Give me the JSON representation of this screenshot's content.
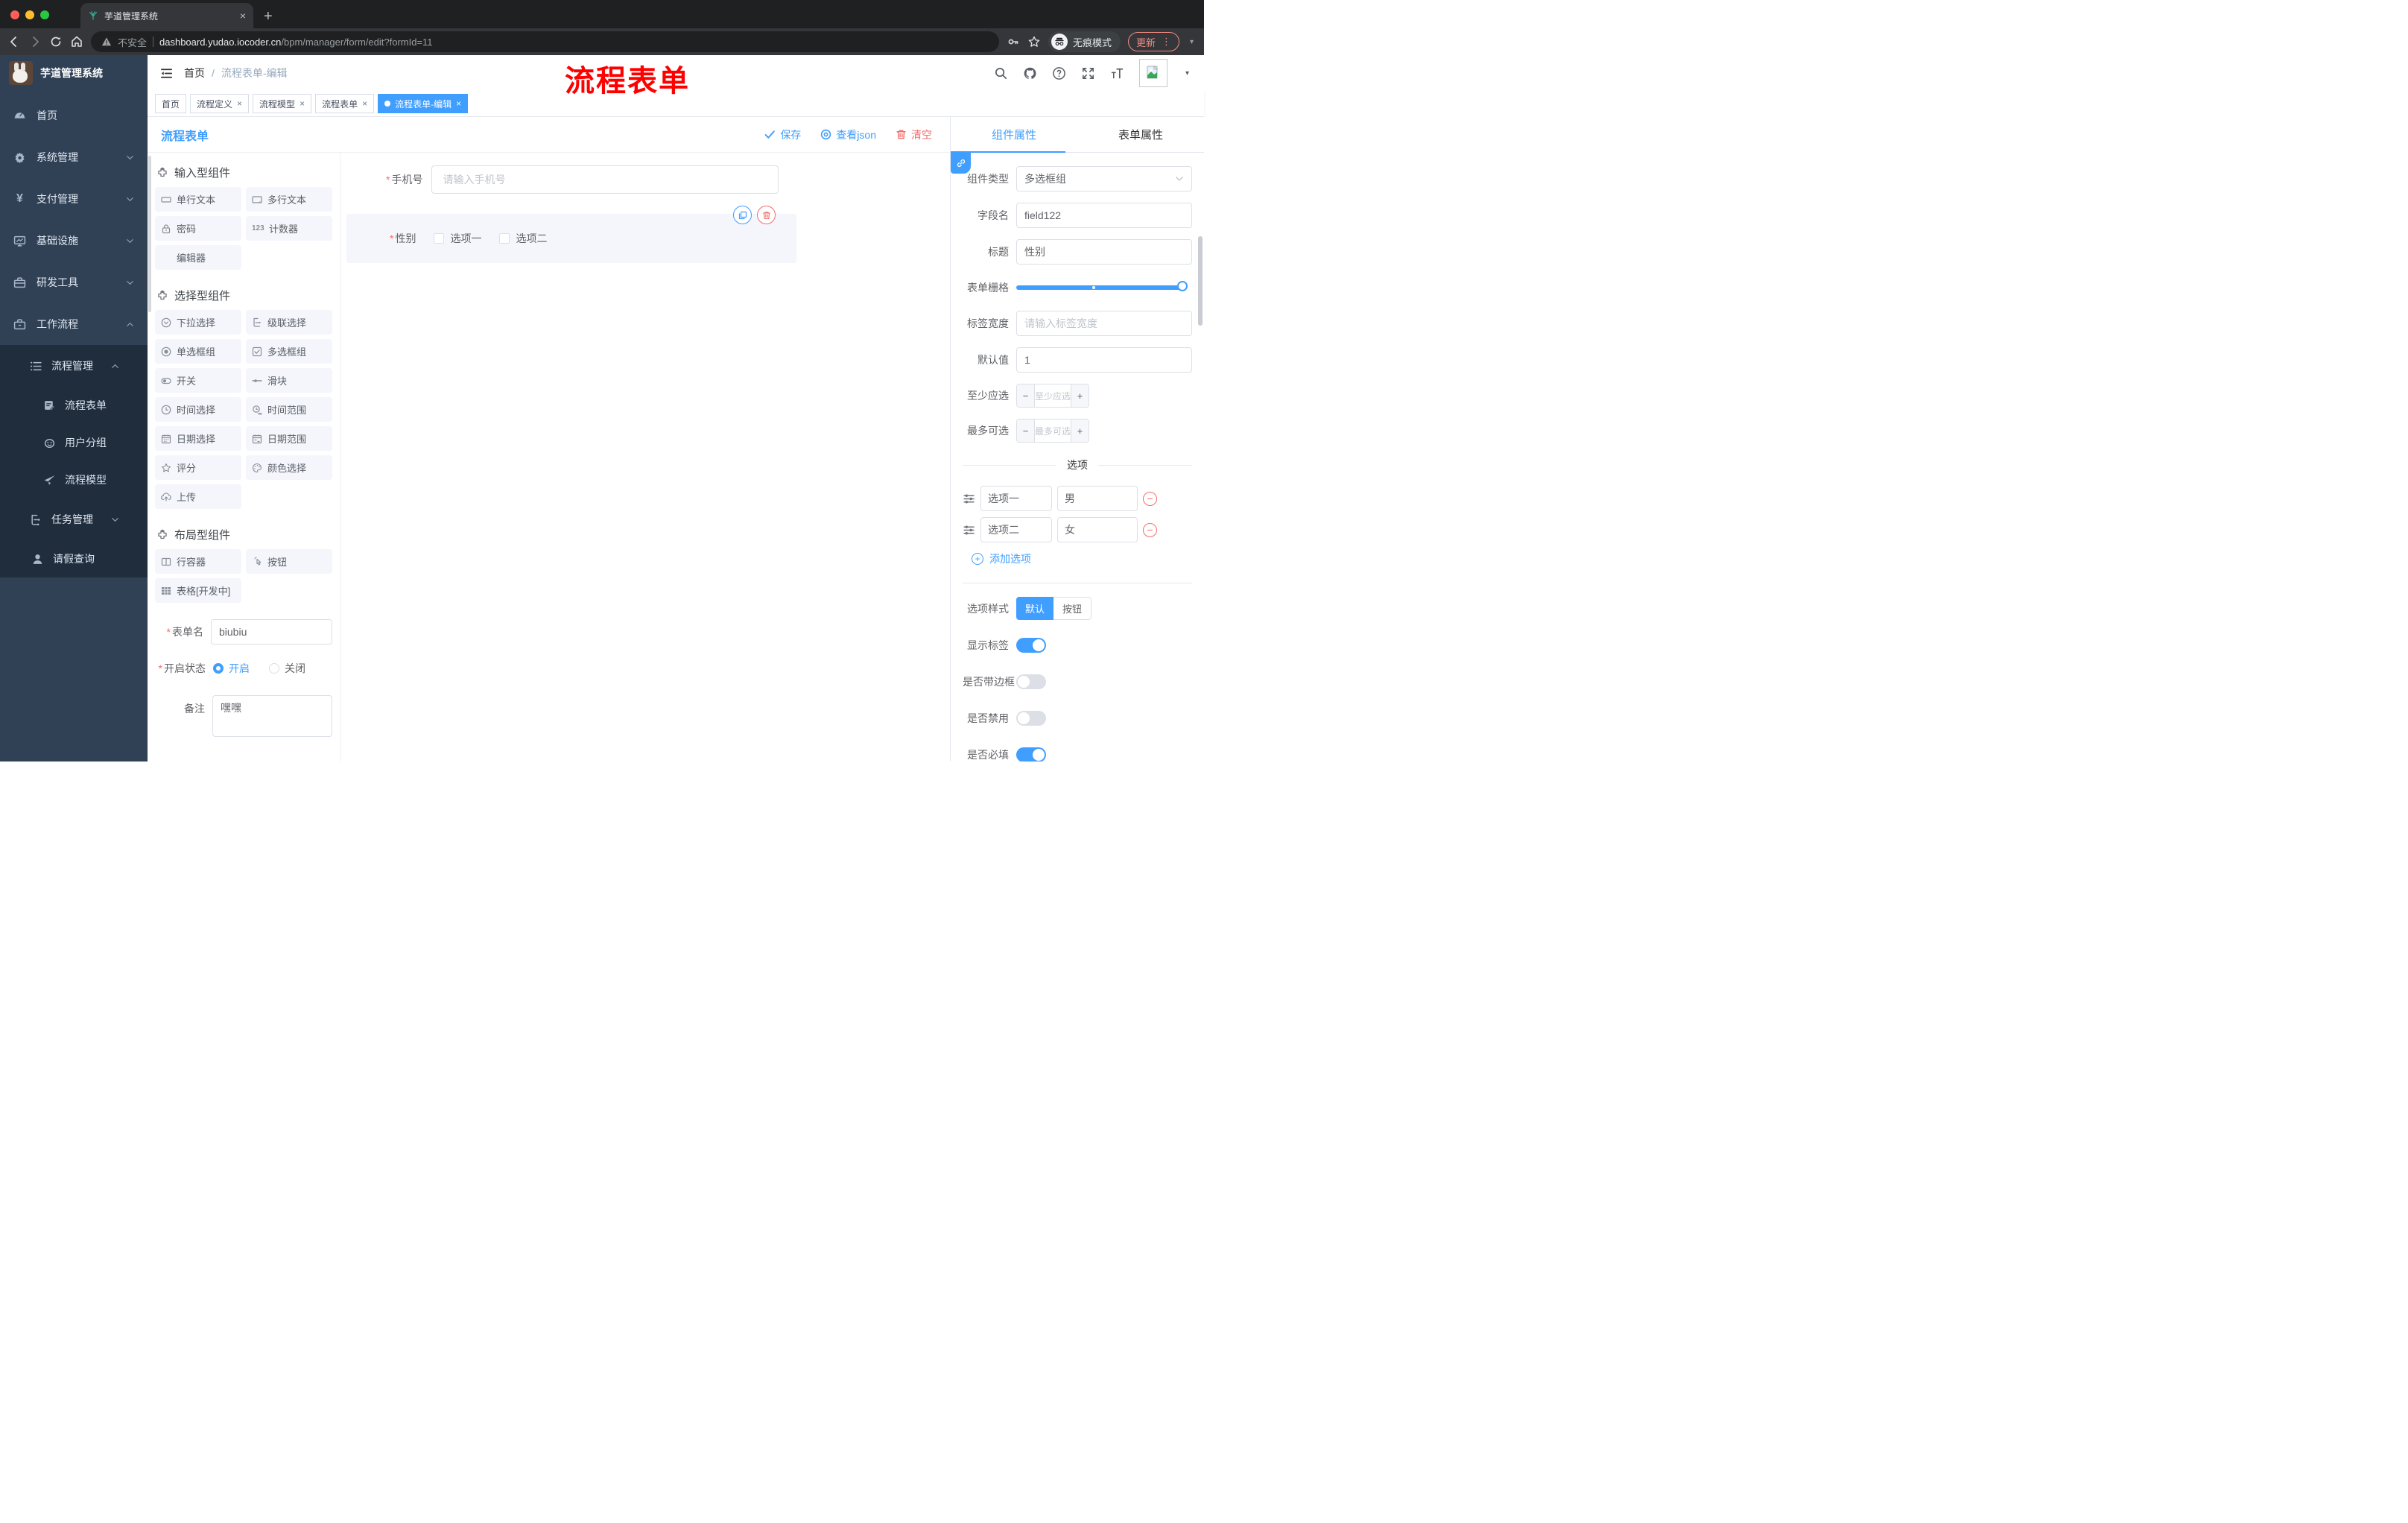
{
  "browser": {
    "tab_title": "芋道管理系统",
    "insecure_label": "不安全",
    "url_host": "dashboard.yudao.iocoder.cn",
    "url_path": "/bpm/manager/form/edit?formId=11",
    "incognito_label": "无痕模式",
    "update_label": "更新"
  },
  "header": {
    "breadcrumb_home": "首页",
    "breadcrumb_sep": "/",
    "breadcrumb_current": "流程表单-编辑",
    "overlay_title": "流程表单"
  },
  "tags": {
    "items": [
      {
        "label": "首页"
      },
      {
        "label": "流程定义"
      },
      {
        "label": "流程模型"
      },
      {
        "label": "流程表单"
      },
      {
        "label": "流程表单-编辑"
      }
    ]
  },
  "sidebar": {
    "app_title": "芋道管理系统",
    "items": [
      {
        "label": "首页"
      },
      {
        "label": "系统管理"
      },
      {
        "label": "支付管理"
      },
      {
        "label": "基础设施"
      },
      {
        "label": "研发工具"
      },
      {
        "label": "工作流程"
      },
      {
        "label": "流程管理"
      },
      {
        "label": "流程表单"
      },
      {
        "label": "用户分组"
      },
      {
        "label": "流程模型"
      },
      {
        "label": "任务管理"
      },
      {
        "label": "请假查询"
      }
    ]
  },
  "designer": {
    "title": "流程表单",
    "save_label": "保存",
    "json_label": "查看json",
    "clear_label": "清空",
    "groups": [
      {
        "title": "输入型组件"
      },
      {
        "title": "选择型组件"
      },
      {
        "title": "布局型组件"
      }
    ],
    "components": {
      "input": "单行文本",
      "textarea": "多行文本",
      "password": "密码",
      "counter": "计数器",
      "editor": "编辑器",
      "select": "下拉选择",
      "cascader": "级联选择",
      "radio": "单选框组",
      "checkbox": "多选框组",
      "switch": "开关",
      "slider": "滑块",
      "time": "时间选择",
      "time_range": "时间范围",
      "date": "日期选择",
      "date_range": "日期范围",
      "rate": "评分",
      "color": "颜色选择",
      "upload": "上传",
      "row": "行容器",
      "button": "按钮",
      "table": "表格[开发中]"
    },
    "meta": {
      "form_name_label": "表单名",
      "form_name_value": "biubiu",
      "status_label": "开启状态",
      "status_on": "开启",
      "status_off": "关闭",
      "remark_label": "备注",
      "remark_value": "嘿嘿"
    },
    "canvas": {
      "phone_label": "手机号",
      "phone_placeholder": "请输入手机号",
      "gender_label": "性别",
      "opt1": "选项一",
      "opt2": "选项二"
    }
  },
  "props": {
    "tab_component": "组件属性",
    "tab_form": "表单属性",
    "type_label": "组件类型",
    "type_value": "多选框组",
    "field_label": "字段名",
    "field_value": "field122",
    "title_label": "标题",
    "title_value": "性别",
    "grid_label": "表单栅格",
    "width_label": "标签宽度",
    "width_placeholder": "请输入标签宽度",
    "default_label": "默认值",
    "default_value": "1",
    "min_label": "至少应选",
    "min_placeholder": "至少应选",
    "max_label": "最多可选",
    "max_placeholder": "最多可选",
    "options_title": "选项",
    "opt_rows": [
      {
        "label": "选项一",
        "value": "男"
      },
      {
        "label": "选项二",
        "value": "女"
      }
    ],
    "add_option": "添加选项",
    "style_label": "选项样式",
    "style_default": "默认",
    "style_button": "按钮",
    "toggle_rows": [
      {
        "label": "显示标签"
      },
      {
        "label": "是否带边框"
      },
      {
        "label": "是否禁用"
      },
      {
        "label": "是否必填"
      }
    ]
  },
  "glyphs": {
    "close": "×",
    "plus": "+",
    "minus": "−",
    "caret": "▾",
    "vdots": "⋮",
    "yen": "¥",
    "num": "123",
    "asterisk": "*"
  },
  "colors": {
    "accent": "#409eff",
    "danger": "#f56c6c",
    "overlay_red": "#ff0000",
    "update_red": "#f28b82"
  }
}
